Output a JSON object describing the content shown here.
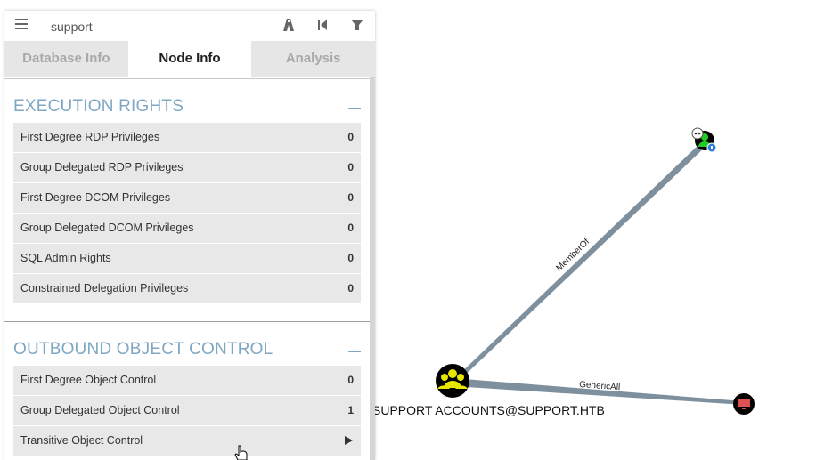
{
  "search": {
    "value": "support",
    "placeholder": ""
  },
  "toolbar": {
    "icons": [
      "pathfinding-icon",
      "back-icon",
      "filter-icon"
    ]
  },
  "tabs": [
    {
      "label": "Database Info",
      "active": false
    },
    {
      "label": "Node Info",
      "active": true
    },
    {
      "label": "Analysis",
      "active": false
    }
  ],
  "sections": {
    "execution_rights": {
      "title": "EXECUTION RIGHTS",
      "rows": [
        {
          "label": "First Degree RDP Privileges",
          "value": "0"
        },
        {
          "label": "Group Delegated RDP Privileges",
          "value": "0"
        },
        {
          "label": "First Degree DCOM Privileges",
          "value": "0"
        },
        {
          "label": "Group Delegated DCOM Privileges",
          "value": "0"
        },
        {
          "label": "SQL Admin Rights",
          "value": "0"
        },
        {
          "label": "Constrained Delegation Privileges",
          "value": "0"
        }
      ]
    },
    "outbound_control": {
      "title": "OUTBOUND OBJECT CONTROL",
      "rows": [
        {
          "label": "First Degree Object Control",
          "value": "0"
        },
        {
          "label": "Group Delegated Object Control",
          "value": "1"
        },
        {
          "label": "Transitive Object Control",
          "value": ""
        }
      ]
    }
  },
  "graph": {
    "edges": [
      {
        "label": "MemberOf"
      },
      {
        "label": "GenericAll"
      }
    ],
    "nodes": [
      {
        "label": "SUPPORT ACCOUNTS@SUPPORT.HTB",
        "type": "group"
      },
      {
        "label": "",
        "type": "user"
      },
      {
        "label": "",
        "type": "computer"
      }
    ]
  },
  "colors": {
    "accent": "#7fa7c3",
    "group_node": "#e6e600",
    "edge": "#7e909e",
    "computer_node": "#e05050"
  }
}
